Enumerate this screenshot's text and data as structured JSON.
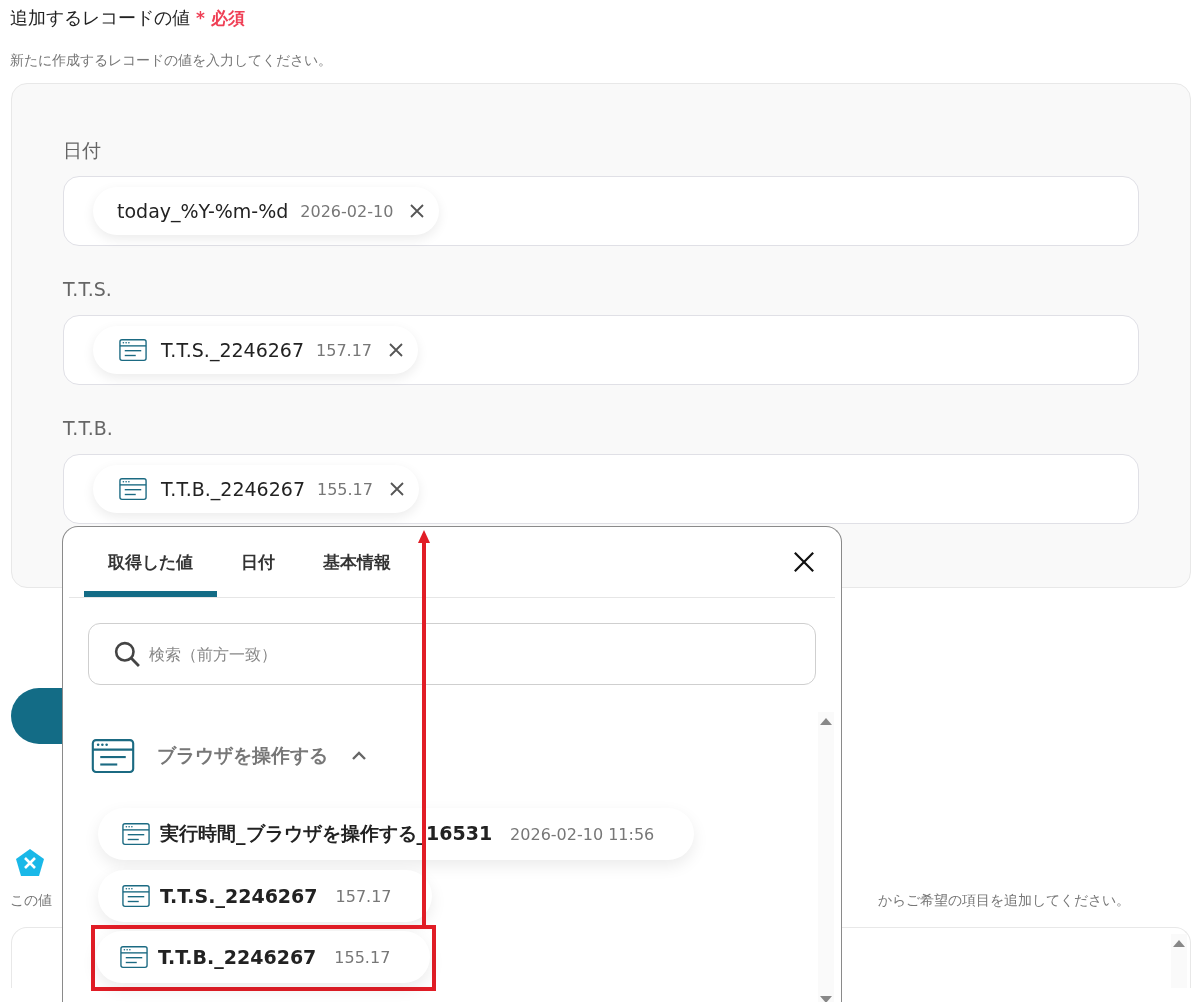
{
  "section": {
    "title": "追加するレコードの値",
    "required_mark": "*",
    "required_label": "必須",
    "description": "新たに作成するレコードの値を入力してください。"
  },
  "fields": [
    {
      "label": "日付",
      "chip": {
        "kind": "date",
        "name": "today_%Y-%m-%d",
        "value": "2026-02-10"
      }
    },
    {
      "label": "T.T.S.",
      "chip": {
        "kind": "browser",
        "name": "T.T.S._2246267",
        "value": "157.17"
      }
    },
    {
      "label": "T.T.B.",
      "chip": {
        "kind": "browser",
        "name": "T.T.B._2246267",
        "value": "155.17"
      }
    }
  ],
  "next_section": {
    "description_start": "この値",
    "description_end": "からご希望の項目を追加してください。"
  },
  "popup": {
    "tabs": [
      {
        "label": "取得した値",
        "selected": true
      },
      {
        "label": "日付",
        "selected": false
      },
      {
        "label": "基本情報",
        "selected": false
      }
    ],
    "search": {
      "placeholder": "検索（前方一致）"
    },
    "groups": [
      {
        "title": "ブラウザを操作する",
        "expanded": true,
        "items": [
          {
            "name": "実行時間_ブラウザを操作する_16531",
            "value": "2026-02-10 11:56",
            "highlighted": false
          },
          {
            "name": "T.T.S._2246267",
            "value": "157.17",
            "highlighted": false
          },
          {
            "name": "T.T.B._2246267",
            "value": "155.17",
            "highlighted": true
          }
        ]
      }
    ]
  }
}
